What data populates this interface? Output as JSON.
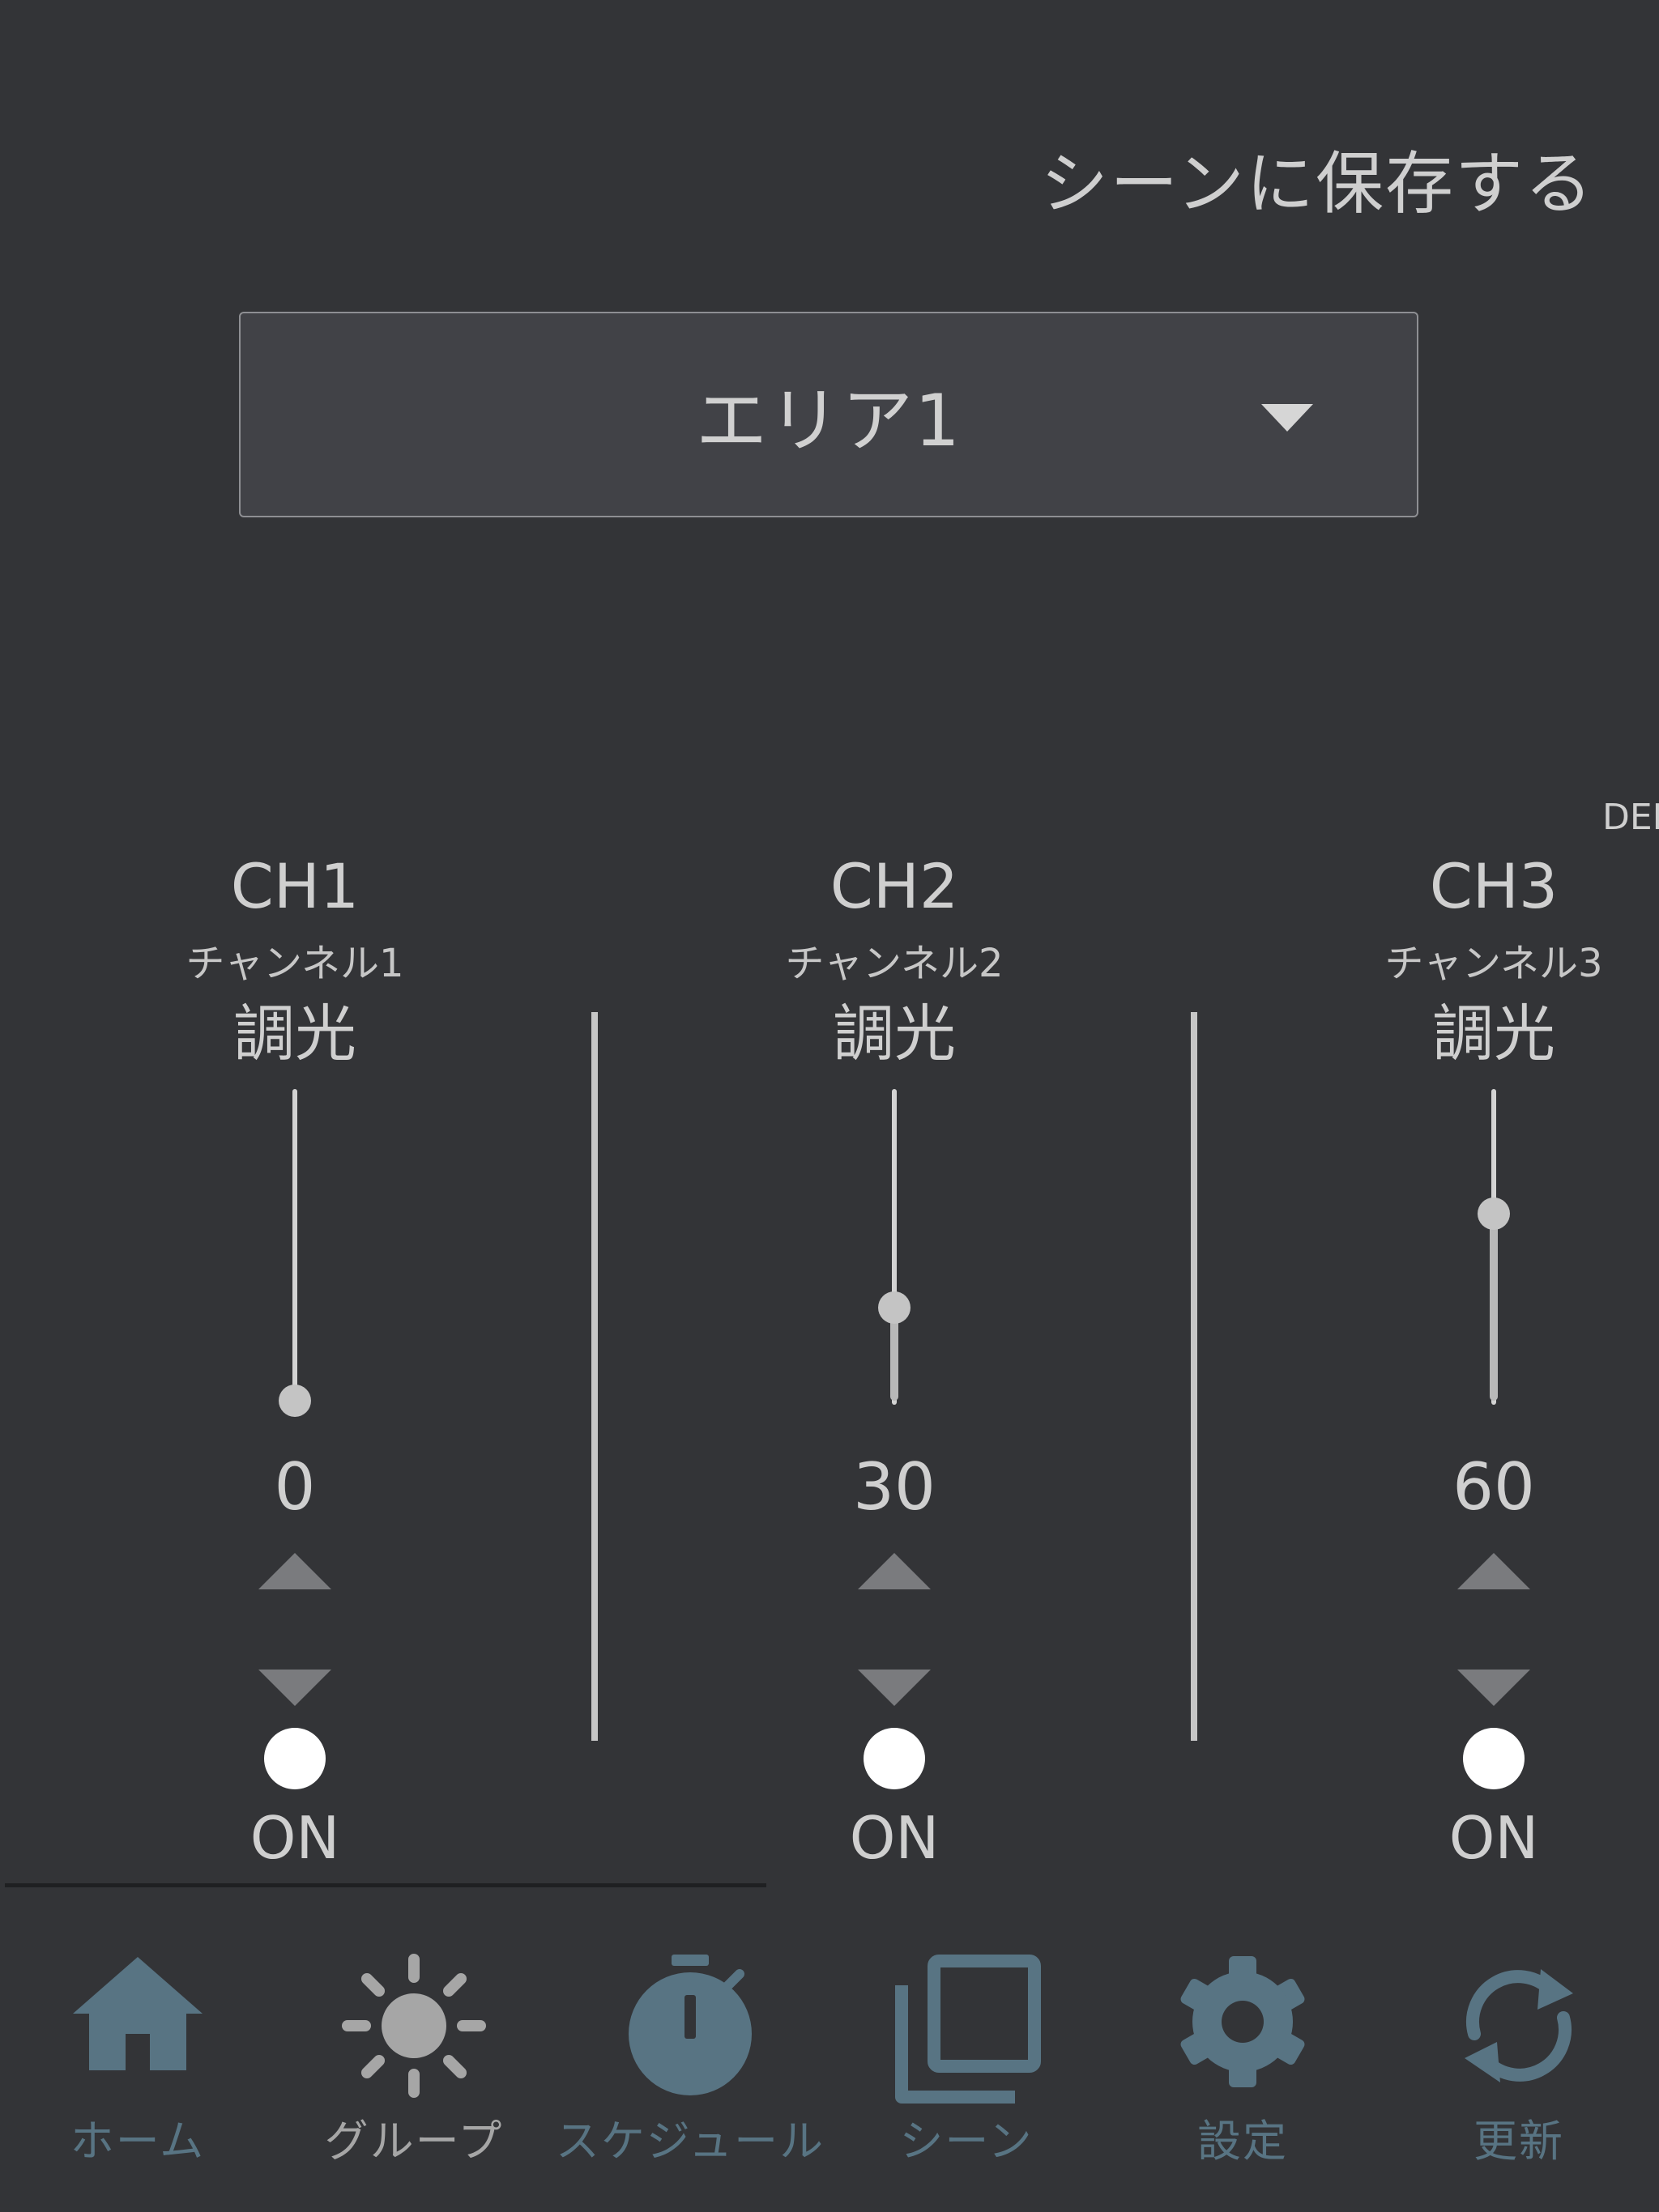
{
  "header": {
    "save_scene_label": "シーンに保存する"
  },
  "area_select": {
    "selected": "エリア1"
  },
  "demo_tag": "DEM",
  "channels": [
    {
      "name": "CH1",
      "subtitle": "チャンネル1",
      "mode": "調光",
      "value": "0",
      "level_percent": 0,
      "toggle_label": "ON"
    },
    {
      "name": "CH2",
      "subtitle": "チャンネル2",
      "mode": "調光",
      "value": "30",
      "level_percent": 30,
      "toggle_label": "ON"
    },
    {
      "name": "CH3",
      "subtitle": "チャンネル3",
      "mode": "調光",
      "value": "60",
      "level_percent": 60,
      "toggle_label": "ON"
    }
  ],
  "nav": {
    "items": [
      {
        "label": "ホーム",
        "icon": "home-icon"
      },
      {
        "label": "グループ",
        "icon": "sun-icon",
        "active": true
      },
      {
        "label": "スケジュール",
        "icon": "stopwatch-icon"
      },
      {
        "label": "シーン",
        "icon": "copy-icon"
      },
      {
        "label": "設定",
        "icon": "gear-icon"
      },
      {
        "label": "更新",
        "icon": "refresh-icon"
      }
    ]
  },
  "colors": {
    "background": "#333437",
    "nav_icon": "#587483",
    "nav_active": "#a6a6a6",
    "toggle_on": "#ffffff"
  }
}
